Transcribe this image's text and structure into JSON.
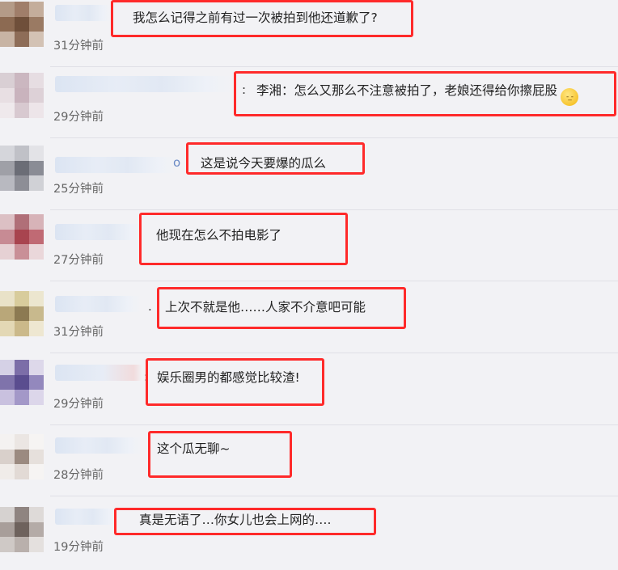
{
  "comments": [
    {
      "text": "我怎么记得之前有过一次被拍到他还道歉了?",
      "time": "31分钟前",
      "colon": ""
    },
    {
      "text": "李湘：怎么又那么不注意被拍了，老娘还得给你擦屁股",
      "time": "29分钟前",
      "colon": ":",
      "emoji": "-_-",
      "emoji_name": "sleepy-face-emoji"
    },
    {
      "text": "这是说今天要爆的瓜么",
      "time": "25分钟前",
      "colon": "o"
    },
    {
      "text": "他现在怎么不拍电影了",
      "time": "27分钟前",
      "colon": ""
    },
    {
      "text": "上次不就是他……人家不介意吧可能",
      "time": "31分钟前",
      "colon": "."
    },
    {
      "text": "娱乐圈男的都感觉比较渣!",
      "time": "29分钟前",
      "colon": ":"
    },
    {
      "text": "这个瓜无聊~",
      "time": "28分钟前",
      "colon": ""
    },
    {
      "text": "真是无语了…你女儿也会上网的….",
      "time": "19分钟前",
      "colon": ""
    }
  ],
  "colors": {
    "highlight": "#ff2a2a",
    "background": "#f2f2f5",
    "time_text": "#666666"
  }
}
